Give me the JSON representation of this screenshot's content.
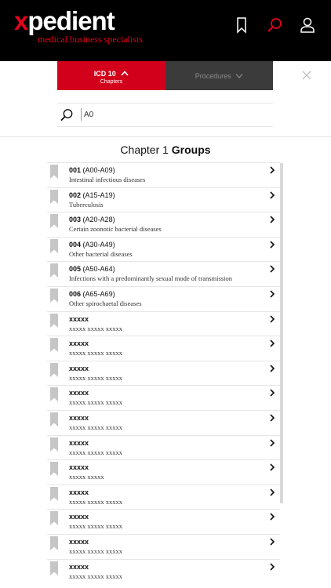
{
  "header": {
    "logo_x": "x",
    "logo_rest": "pedient",
    "logo_tagline": "medical business specialists",
    "icons": [
      "bookmark-icon",
      "search-icon",
      "user-icon"
    ],
    "accent": "#e3001b"
  },
  "tabs": [
    {
      "label": "ICD 10",
      "sublabel": "Chapters",
      "active": true
    },
    {
      "label": "Procedures",
      "active": false
    }
  ],
  "search": {
    "value": "A0"
  },
  "heading": {
    "prefix": "Chapter 1",
    "bold": "Groups"
  },
  "groups": [
    {
      "num": "001",
      "range": "(A00-A09)",
      "desc": "Intestinal infectious diseases"
    },
    {
      "num": "002",
      "range": "(A15-A19)",
      "desc": "Tuberculosis"
    },
    {
      "num": "003",
      "range": "(A20-A28)",
      "desc": "Certain zoonotic bacterial diseases"
    },
    {
      "num": "004",
      "range": "(A30-A49)",
      "desc": "Other bacterial diseases"
    },
    {
      "num": "005",
      "range": "(A50-A64)",
      "desc": "Infections with a predominantly sexual mode of transmission"
    },
    {
      "num": "006",
      "range": "(A65-A69)",
      "desc": "Other spirochaetal diseases"
    },
    {
      "num": "xxxxx",
      "range": "",
      "desc": "xxxxx xxxxx xxxxx"
    },
    {
      "num": "xxxxx",
      "range": "",
      "desc": "xxxxx xxxxx xxxxx"
    },
    {
      "num": "xxxxx",
      "range": "",
      "desc": "xxxxx xxxxx xxxxx"
    },
    {
      "num": "xxxxx",
      "range": "",
      "desc": "xxxxx xxxxx xxxxx"
    },
    {
      "num": "xxxxx",
      "range": "",
      "desc": "xxxxx xxxxx xxxxx"
    },
    {
      "num": "xxxxx",
      "range": "",
      "desc": "xxxxx xxxxx xxxxx"
    },
    {
      "num": "xxxxx",
      "range": "",
      "desc": "xxxxx xxxxx"
    },
    {
      "num": "xxxxx",
      "range": "",
      "desc": "xxxxx xxxxx xxxxx"
    },
    {
      "num": "xxxxx",
      "range": "",
      "desc": "xxxxx xxxxx xxxxx"
    },
    {
      "num": "xxxxx",
      "range": "",
      "desc": "xxxxx xxxxx xxxxx"
    },
    {
      "num": "xxxxx",
      "range": "",
      "desc": "xxxxx xxxxx xxxxx"
    }
  ]
}
